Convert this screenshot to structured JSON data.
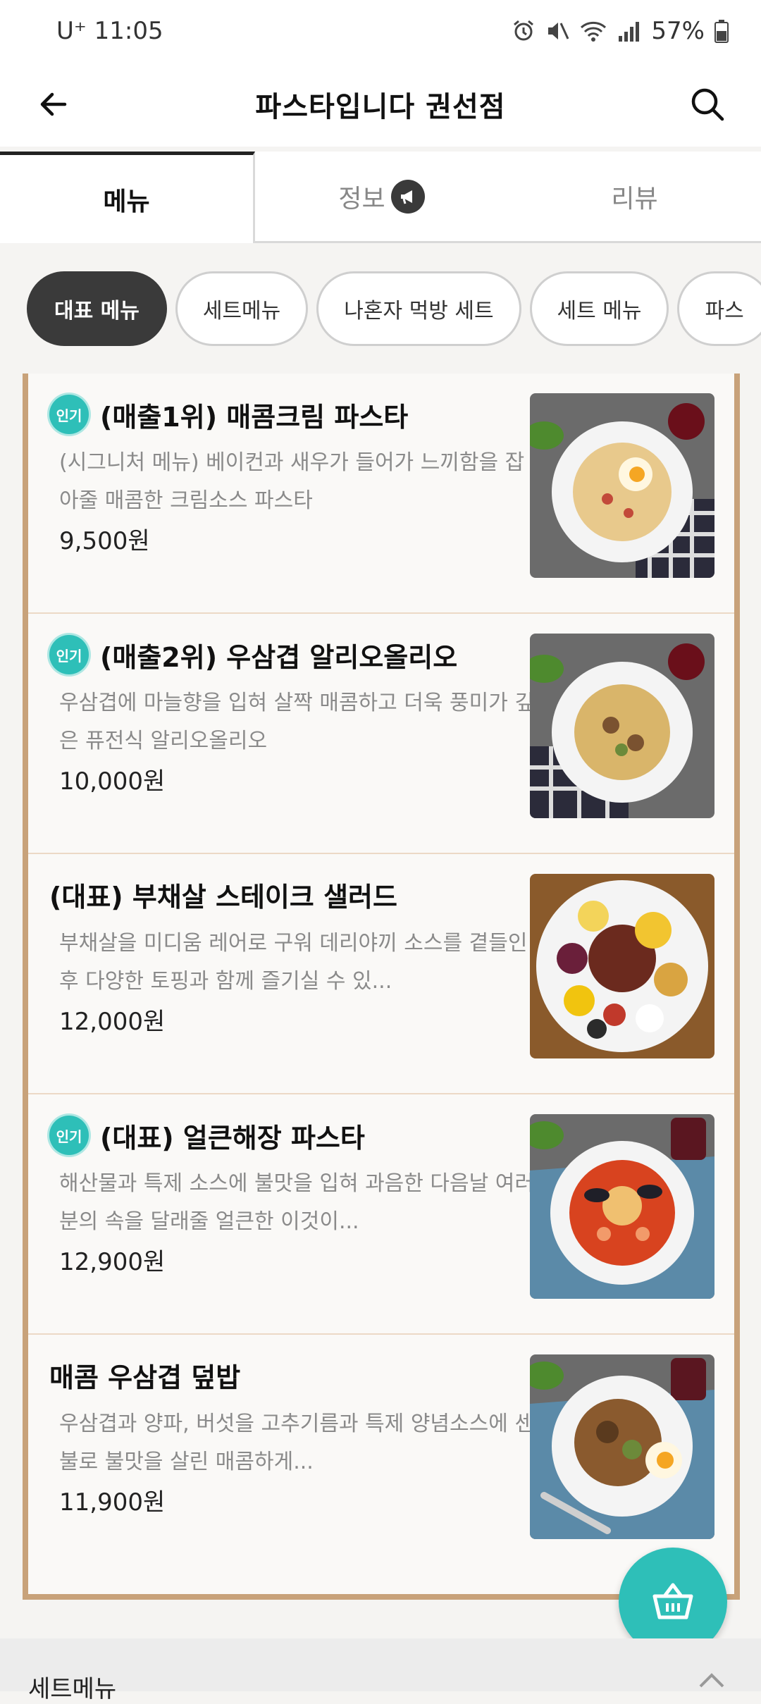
{
  "status_bar": {
    "carrier_time": "U⁺ 11:05",
    "battery": "57%",
    "icons": [
      "alarm-icon",
      "mute-icon",
      "wifi-icon",
      "signal-icon",
      "battery-icon"
    ]
  },
  "header": {
    "title": "파스타입니다 권선점",
    "back_icon": "arrow-left-icon",
    "search_icon": "search-icon"
  },
  "tabs": [
    {
      "label": "메뉴",
      "active": true
    },
    {
      "label": "정보",
      "active": false,
      "badge_icon": "megaphone-icon"
    },
    {
      "label": "리뷰",
      "active": false
    }
  ],
  "chips": [
    {
      "label": "대표 메뉴",
      "active": true
    },
    {
      "label": "세트메뉴",
      "active": false
    },
    {
      "label": "나혼자 먹방 세트",
      "active": false
    },
    {
      "label": "세트 메뉴",
      "active": false
    },
    {
      "label": "파스",
      "active": false
    }
  ],
  "popular_badge": "인기",
  "menu_items": [
    {
      "title": "(매출1위) 매콤크림 파스타",
      "desc": "(시그니처 메뉴) 베이컨과 새우가 들어가 느끼함을 잡아줄 매콤한 크림소스 파스타",
      "price": "9,500원",
      "popular": true
    },
    {
      "title": "(매출2위) 우삼겹 알리오올리오",
      "desc": "우삼겹에 마늘향을 입혀 살짝 매콤하고 더욱 풍미가 깊은 퓨전식 알리오올리오",
      "price": "10,000원",
      "popular": true
    },
    {
      "title": "(대표) 부채살 스테이크 샐러드",
      "desc": "부채살을 미디움 레어로 구워 데리야끼 소스를 곁들인 후 다양한 토핑과 함께 즐기실 수 있...",
      "price": "12,000원",
      "popular": false
    },
    {
      "title": "(대표) 얼큰해장 파스타",
      "desc": "해산물과 특제 소스에 불맛을 입혀 과음한 다음날 여러분의 속을 달래줄 얼큰한 이것이...",
      "price": "12,900원",
      "popular": true
    },
    {
      "title": "매콤 우삼겹 덮밥",
      "desc": "우삼겹과 양파, 버섯을 고추기름과 특제 양념소스에 센불로 불맛을 살린 매콤하게...",
      "price": "11,900원",
      "popular": false
    }
  ],
  "cart_icon": "basket-icon",
  "next_section": {
    "title": "세트메뉴",
    "icon": "chevron-up-icon"
  }
}
